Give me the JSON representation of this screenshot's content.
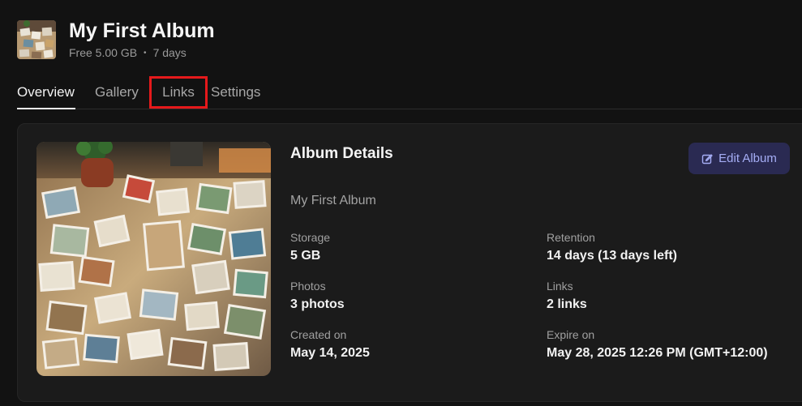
{
  "header": {
    "title": "My First Album",
    "plan": "Free 5.00 GB",
    "separator": "•",
    "duration": "7 days"
  },
  "tabs": [
    {
      "label": "Overview",
      "active": true
    },
    {
      "label": "Gallery",
      "active": false
    },
    {
      "label": "Links",
      "active": false,
      "highlighted": true
    },
    {
      "label": "Settings",
      "active": false
    }
  ],
  "details": {
    "title": "Album Details",
    "album_name": "My First Album",
    "edit_label": "Edit Album",
    "fields": {
      "storage": {
        "label": "Storage",
        "value": "5 GB"
      },
      "retention": {
        "label": "Retention",
        "value": "14 days (13 days left)"
      },
      "photos": {
        "label": "Photos",
        "value": "3 photos"
      },
      "links": {
        "label": "Links",
        "value": "2 links"
      },
      "created": {
        "label": "Created on",
        "value": "May 14, 2025"
      },
      "expire": {
        "label": "Expire on",
        "value": "May 28, 2025 12:26 PM (GMT+12:00)"
      }
    }
  },
  "icons": {
    "thumbnail": "album-thumbnail-image",
    "cover": "album-cover-image",
    "edit": "edit-pencil-icon"
  },
  "colors": {
    "background": "#121212",
    "card": "#1b1b1b",
    "accent": "#a5adf5",
    "accent_bg": "#2a2a52",
    "highlight": "#e5191b"
  }
}
